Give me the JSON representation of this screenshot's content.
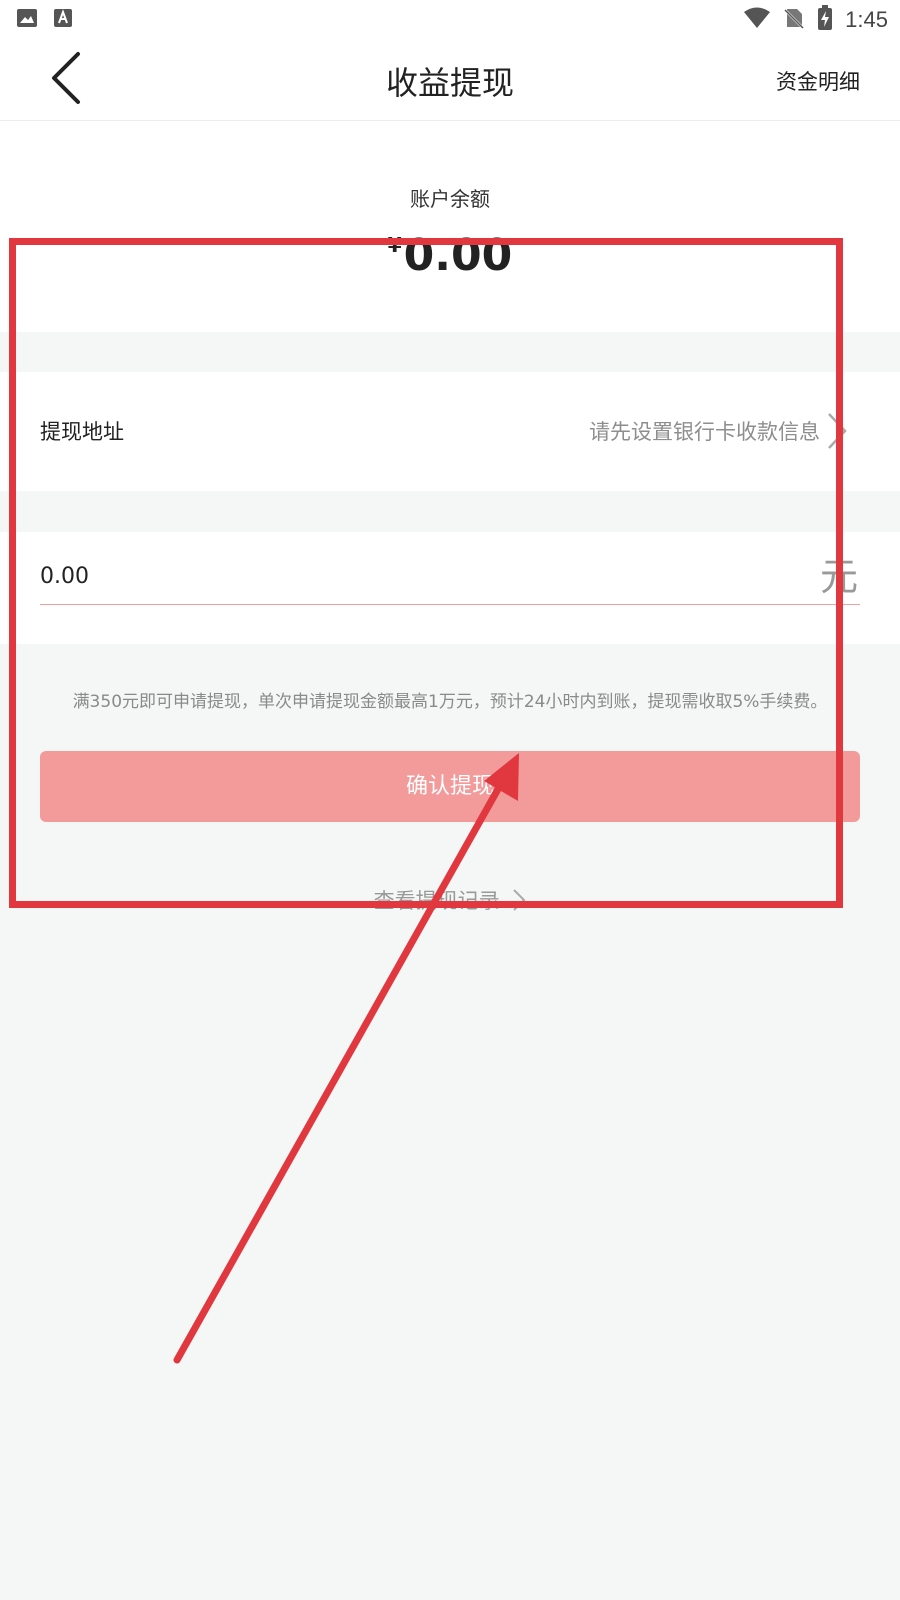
{
  "status_bar": {
    "time": "1:45",
    "left_icons": [
      "image-icon",
      "text-a-icon"
    ],
    "right_icons": [
      "wifi-icon",
      "no-sim-icon",
      "battery-charging-icon"
    ]
  },
  "header": {
    "title": "收益提现",
    "right_link": "资金明细",
    "back_icon": "chevron-left-icon"
  },
  "balance": {
    "label": "账户余额",
    "currency": "¥",
    "amount": "0.00"
  },
  "withdraw_address": {
    "label": "提现地址",
    "value": "请先设置银行卡收款信息"
  },
  "amount_input": {
    "value": "0.00",
    "unit": "元"
  },
  "notice": "满350元即可申请提现，单次申请提现金额最高1万元，预计24小时内到账，提现需收取5%手续费。",
  "confirm_button": "确认提现",
  "history_link": "查看提现记录",
  "colors": {
    "accent": "#f39b9b",
    "annotation": "#e0383e",
    "background": "#f5f6f6"
  }
}
